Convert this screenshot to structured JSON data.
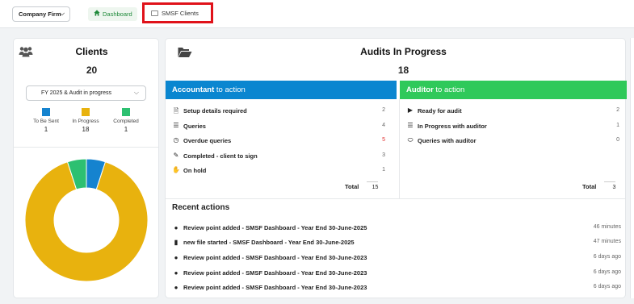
{
  "topbar": {
    "firm_select": "Company Firm",
    "tabs": [
      {
        "label": "Dashboard",
        "icon": "home-icon"
      },
      {
        "label": "SMSF Clients",
        "icon": "folder-icon"
      }
    ]
  },
  "clients": {
    "title": "Clients",
    "count": "20",
    "filter": "FY 2025 & Audit in progress",
    "legend": [
      {
        "label": "To Be Sent",
        "value": "1",
        "color": "#1583cf"
      },
      {
        "label": "In Progress",
        "value": "18",
        "color": "#e8b20e"
      },
      {
        "label": "Completed",
        "value": "1",
        "color": "#2dc071"
      }
    ],
    "donut_values": [
      1,
      18,
      1
    ]
  },
  "audits": {
    "title": "Audits In Progress",
    "count": "18",
    "accountant": {
      "heading_bold": "Accountant",
      "heading_rest": " to action",
      "items": [
        {
          "icon": "clipboard-icon",
          "label": "Setup details required",
          "count": "2"
        },
        {
          "icon": "list-icon",
          "label": "Queries",
          "count": "4"
        },
        {
          "icon": "clock-icon",
          "label": "Overdue queries",
          "count": "5"
        },
        {
          "icon": "edit-icon",
          "label": "Completed - client to sign",
          "count": "3"
        },
        {
          "icon": "hand-icon",
          "label": "On hold",
          "count": "1"
        }
      ],
      "total_label": "Total",
      "total": "15"
    },
    "auditor": {
      "heading_bold": "Auditor",
      "heading_rest": " to action",
      "items": [
        {
          "icon": "play-icon",
          "label": "Ready for audit",
          "count": "2"
        },
        {
          "icon": "list-icon",
          "label": "In Progress with auditor",
          "count": "1"
        },
        {
          "icon": "comment-icon",
          "label": "Queries with auditor",
          "count": "0"
        }
      ],
      "total_label": "Total",
      "total": "3"
    }
  },
  "recent": {
    "title": "Recent actions",
    "items": [
      {
        "icon": "comment-icon",
        "text": "Review point added - SMSF Dashboard - Year End 30-June-2025",
        "time": "46 minutes"
      },
      {
        "icon": "file-icon",
        "text": "new file started - SMSF Dashboard - Year End 30-June-2025",
        "time": "47 minutes"
      },
      {
        "icon": "comment-icon",
        "text": "Review point added - SMSF Dashboard - Year End 30-June-2023",
        "time": "6 days ago"
      },
      {
        "icon": "comment-icon",
        "text": "Review point added - SMSF Dashboard - Year End 30-June-2023",
        "time": "6 days ago"
      },
      {
        "icon": "comment-icon",
        "text": "Review point added - SMSF Dashboard - Year End 30-June-2023",
        "time": "6 days ago"
      }
    ]
  }
}
